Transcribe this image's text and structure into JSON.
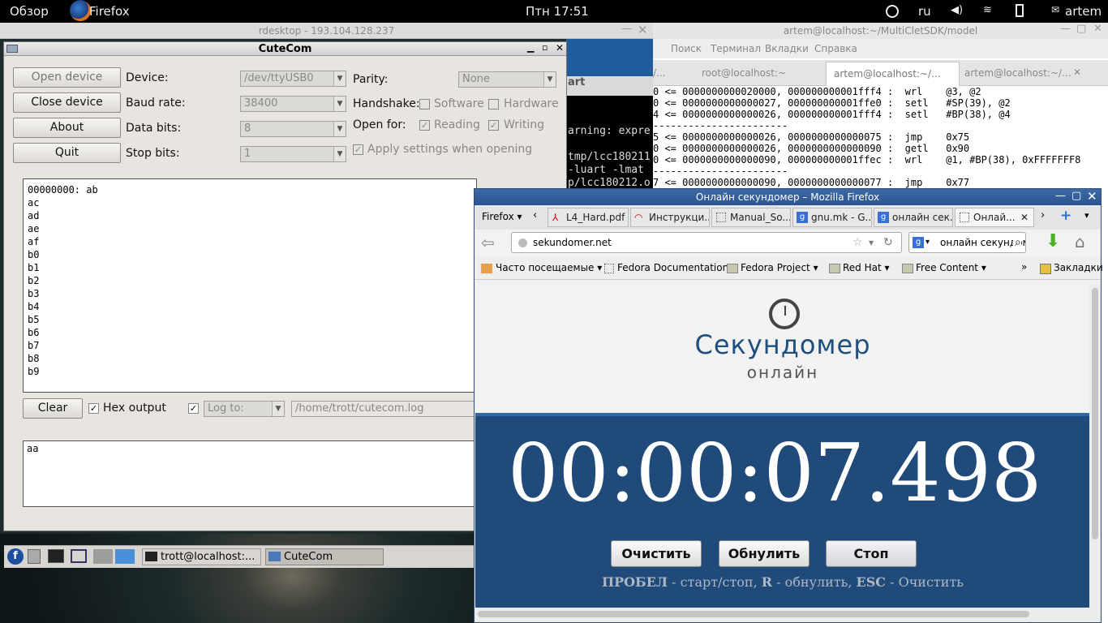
{
  "topbar": {
    "overview": "Обзор",
    "app": "Firefox",
    "clock": "Птн 17:51",
    "lang": "ru",
    "user": "artem"
  },
  "rdesktop": {
    "title": "rdesktop - 193.104.128.237",
    "remote_lines": [
      "art",
      "arning: expre",
      "tmp/lcc180211",
      " -luart -lmat",
      "p/lcc180212.o"
    ]
  },
  "cutecom": {
    "title": "CuteCom",
    "buttons": {
      "open": "Open device",
      "close": "Close device",
      "about": "About",
      "quit": "Quit",
      "clear": "Clear"
    },
    "labels": {
      "device": "Device:",
      "baud": "Baud rate:",
      "databits": "Data bits:",
      "stopbits": "Stop bits:",
      "parity": "Parity:",
      "handshake": "Handshake:",
      "openfor": "Open for:",
      "apply": "Apply settings when opening",
      "software": "Software",
      "hardware": "Hardware",
      "reading": "Reading",
      "writing": "Writing",
      "hex": "Hex output"
    },
    "values": {
      "device": "/dev/ttyUSB0",
      "baud": "38400",
      "databits": "8",
      "stopbits": "1",
      "parity": "None",
      "logto": "Log to:",
      "logpath": "/home/trott/cutecom.log",
      "input": "aa"
    },
    "output": [
      "00000000: ab",
      "ac",
      "ad",
      "ae",
      "af",
      "b0",
      "b1",
      "b2",
      "b3",
      "b4",
      "b5",
      "b6",
      "b7",
      "b8",
      "b9"
    ]
  },
  "taskbar": {
    "item1": "trott@localhost:...",
    "item2": "CuteCom"
  },
  "terminal": {
    "title": "artem@localhost:~/MultiCletSDK/model",
    "menu": [
      "Поиск",
      "Терминал",
      "Вкладки",
      "Справка"
    ],
    "tabs": [
      "/...",
      "root@localhost:~",
      "artem@localhost:~/...",
      "artem@localhost:~/..."
    ],
    "lines": [
      "0 <= 0000000000020000, 000000000001fff4 :  wrl    @3, @2",
      "0 <= 0000000000000027, 000000000001ffe0 :  setl   #SP(39), @2",
      "4 <= 0000000000000026, 000000000001fff4 :  setl   #BP(38), @4",
      "-----------------------",
      "5 <= 0000000000000026, 0000000000000075 :  jmp    0x75",
      "0 <= 0000000000000026, 0000000000000090 :  getl   0x90",
      "0 <= 0000000000000090, 000000000001ffec :  wrl    @1, #BP(38), 0xFFFFFFF8",
      "-----------------------",
      "7 <= 0000000000000090, 0000000000000077 :  jmp    0x77"
    ]
  },
  "firefox": {
    "title": "Онлайн секундомер – Mozilla Firefox",
    "menu": "Firefox",
    "tabs": [
      "L4_Hard.pdf",
      "Инструкци...",
      "Manual_So...",
      "gnu.mk - G...",
      "онлайн сек...",
      "Онлай..."
    ],
    "url": "sekundomer.net",
    "search": "онлайн секундомер",
    "bookmarks": [
      "Часто посещаемые",
      "Fedora Documentation",
      "Fedora Project",
      "Red Hat",
      "Free Content",
      "Закладки"
    ],
    "logo_main": "Секундомер",
    "logo_sub": "онлайн",
    "time": "00:00:07.498",
    "btn_clear": "Очистить",
    "btn_reset": "Обнулить",
    "btn_stop": "Стоп",
    "hint_b1": "ПРОБЕЛ",
    "hint_t1": " - старт/стоп, ",
    "hint_b2": "R",
    "hint_t2": " - обнулить, ",
    "hint_b3": "ESC",
    "hint_t3": " - Очистить"
  }
}
